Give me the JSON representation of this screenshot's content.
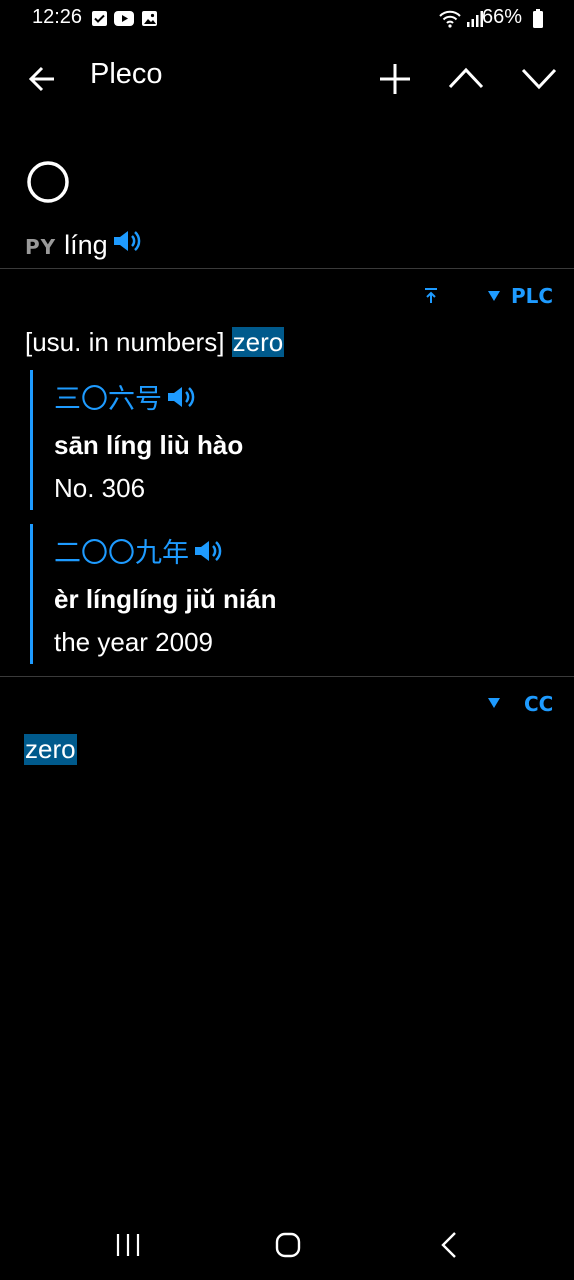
{
  "status_bar": {
    "time": "12:26",
    "battery": "66%"
  },
  "app_bar": {
    "title": "Pleco"
  },
  "headword": {
    "character": "〇",
    "py_tag": "PY",
    "pinyin": "líng"
  },
  "plc_entry": {
    "dict_label": "PLC",
    "definition_prefix": "[usu. in numbers]",
    "definition_word": "zero",
    "examples": [
      {
        "hanzi": "三〇六号",
        "pinyin_pre": "sān ",
        "pinyin_bold": "líng",
        "pinyin_post": " liù hào",
        "english": "No. 306"
      },
      {
        "hanzi": "二〇〇九年",
        "pinyin_pre": "èr ",
        "pinyin_bold": "línglíng",
        "pinyin_post": " jiǔ nián",
        "english": "the year 2009"
      }
    ]
  },
  "cc_entry": {
    "dict_label": "CC",
    "definition_word": "zero"
  },
  "colors": {
    "accent": "#1e9bff",
    "highlight": "#005a8c",
    "background": "#000000"
  }
}
